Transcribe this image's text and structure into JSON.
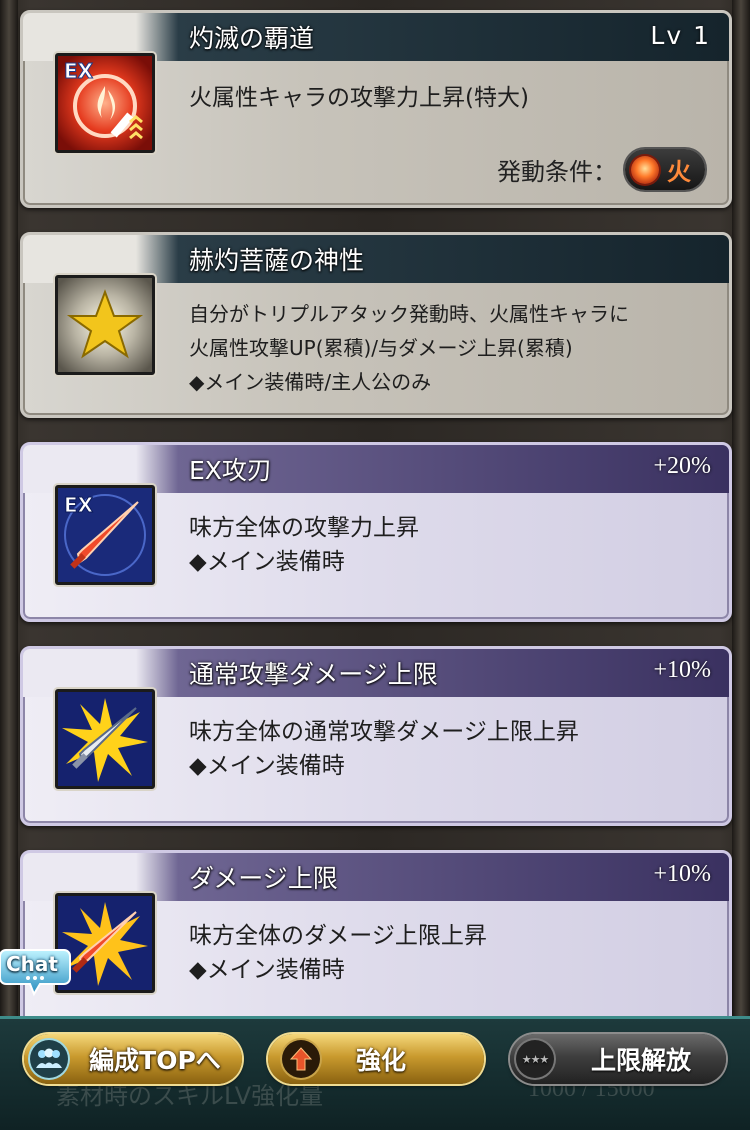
{
  "skills": [
    {
      "name": "灼滅の覇道",
      "right": "Lv 1",
      "lines": "火属性キャラの攻撃力上昇(特大)",
      "condition_label": "発動条件：",
      "condition_value": "火",
      "icon": "ex-fire-sword-icon"
    },
    {
      "name": "赫灼菩薩の神性",
      "lines": "自分がトリプルアタック発動時、火属性キャラに\n火属性攻撃UP(累積)/与ダメージ上昇(累積)\n◆メイン装備時/主人公のみ",
      "icon": "gold-star-icon"
    },
    {
      "name": "EX攻刃",
      "right": "+20%",
      "lines": "味方全体の攻撃力上昇\n◆メイン装備時",
      "icon": "ex-red-sword-icon"
    },
    {
      "name": "通常攻撃ダメージ上限",
      "right": "+10%",
      "lines": "味方全体の通常攻撃ダメージ上限上昇\n◆メイン装備時",
      "icon": "burst-silver-sword-icon"
    },
    {
      "name": "ダメージ上限",
      "right": "+10%",
      "lines": "味方全体のダメージ上限上昇\n◆メイン装備時",
      "icon": "burst-red-sword-icon"
    }
  ],
  "footer": {
    "ghost_left": "素材時のスキルLV強化量",
    "ghost_right": "1000 / 15000",
    "btn_party": "編成TOPへ",
    "btn_enhance": "強化",
    "btn_limit": "上限解放",
    "btn_limit_icon": "★★★"
  },
  "chat": {
    "label": "Chat"
  },
  "colors": {
    "accent_gold": "#c99a2e",
    "fire": "#ff8a3a",
    "purple_bar": "#3a3160",
    "teal_bar": "#15242c"
  }
}
